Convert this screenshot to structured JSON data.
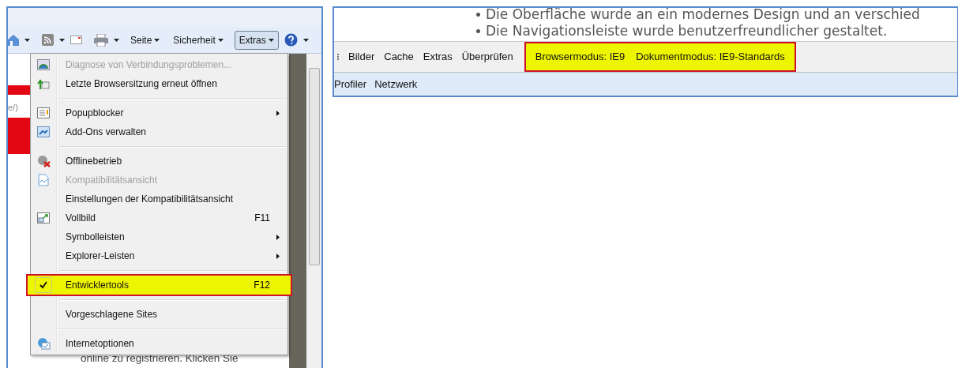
{
  "left_window": {
    "toolbar": {
      "buttons": [
        {
          "label": "Seite",
          "pressed": false
        },
        {
          "label": "Sicherheit",
          "pressed": false
        },
        {
          "label": "Extras",
          "pressed": true
        }
      ]
    },
    "page": {
      "fragment": "e/)",
      "text": "online zu registrieren. Klicken Sie"
    },
    "menu": [
      {
        "kind": "item",
        "label": "Diagnose von Verbindungsproblemen...",
        "disabled": true,
        "submenu": false,
        "checked": false,
        "highlighted": false
      },
      {
        "kind": "item",
        "label": "Letzte Browsersitzung erneut öffnen",
        "disabled": false,
        "submenu": false,
        "checked": false,
        "highlighted": false
      },
      {
        "kind": "separator"
      },
      {
        "kind": "item",
        "label": "Popupblocker",
        "disabled": false,
        "submenu": true,
        "checked": false,
        "highlighted": false
      },
      {
        "kind": "item",
        "label": "Add-Ons verwalten",
        "disabled": false,
        "submenu": false,
        "checked": false,
        "highlighted": false
      },
      {
        "kind": "separator"
      },
      {
        "kind": "item",
        "label": "Offlinebetrieb",
        "disabled": false,
        "submenu": false,
        "checked": false,
        "highlighted": false
      },
      {
        "kind": "item",
        "label": "Kompatibilitätsansicht",
        "disabled": true,
        "submenu": false,
        "checked": false,
        "highlighted": false
      },
      {
        "kind": "item",
        "label": "Einstellungen der Kompatibilitätsansicht",
        "disabled": false,
        "submenu": false,
        "checked": false,
        "highlighted": false
      },
      {
        "kind": "item",
        "label": "Vollbild",
        "shortcut": "F11",
        "disabled": false,
        "submenu": false,
        "checked": false,
        "highlighted": false
      },
      {
        "kind": "item",
        "label": "Symbolleisten",
        "disabled": false,
        "submenu": true,
        "checked": false,
        "highlighted": false
      },
      {
        "kind": "item",
        "label": "Explorer-Leisten",
        "disabled": false,
        "submenu": true,
        "checked": false,
        "highlighted": false
      },
      {
        "kind": "separator"
      },
      {
        "kind": "item",
        "label": "Entwicklertools",
        "shortcut": "F12",
        "disabled": false,
        "submenu": false,
        "checked": true,
        "highlighted": true
      },
      {
        "kind": "separator"
      },
      {
        "kind": "item",
        "label": "Vorgeschlagene Sites",
        "disabled": false,
        "submenu": false,
        "checked": false,
        "highlighted": false
      },
      {
        "kind": "separator"
      },
      {
        "kind": "item",
        "label": "Internetoptionen",
        "disabled": false,
        "submenu": false,
        "checked": false,
        "highlighted": false
      }
    ]
  },
  "right_window": {
    "bullets": [
      "Die Oberfläche wurde an ein modernes Design und an verschied",
      "Die Navigationsleiste wurde benutzerfreundlicher gestaltet."
    ],
    "menu_bar": [
      "Bilder",
      "Cache",
      "Extras",
      "Überprüfen"
    ],
    "modes": {
      "highlighted": true,
      "items": [
        "Browsermodus: IE9",
        "Dokumentmodus: IE9-Standards"
      ]
    },
    "tabs": [
      "Profiler",
      "Netzwerk"
    ]
  }
}
